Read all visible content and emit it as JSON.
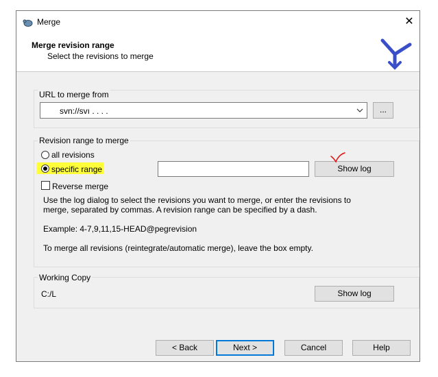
{
  "window": {
    "title": "Merge",
    "close_glyph": "✕"
  },
  "header": {
    "title": "Merge revision range",
    "subtitle": "Select the revisions to merge"
  },
  "url_group": {
    "label": "URL to merge from",
    "url_value": "svn://svı     .      .       .        .",
    "browse_label": "..."
  },
  "range_group": {
    "label": "Revision range to merge",
    "option_all": "all revisions",
    "option_specific": "specific range",
    "selected": "specific range",
    "range_value": "",
    "show_log_label": "Show log",
    "reverse_merge_label": "Reverse merge",
    "reverse_merge_checked": false,
    "help_line1": "Use the log dialog to select the revisions you want to merge, or enter the revisions to",
    "help_line2": "merge, separated by commas. A revision range can be specified by a dash.",
    "example": "Example: 4-7,9,11,15-HEAD@pegrevision",
    "empty_note": "To merge all revisions (reintegrate/automatic merge), leave the box empty."
  },
  "working_copy_group": {
    "label": "Working Copy",
    "path": "C:/L",
    "show_log_label": "Show log"
  },
  "footer": {
    "back_label": "< Back",
    "next_label": "Next >",
    "cancel_label": "Cancel",
    "help_label": "Help"
  },
  "colors": {
    "highlight": "#ffff3a",
    "annotation_check": "#e01010",
    "logo": "#3a4ec8",
    "default_button_border": "#0078d7"
  }
}
